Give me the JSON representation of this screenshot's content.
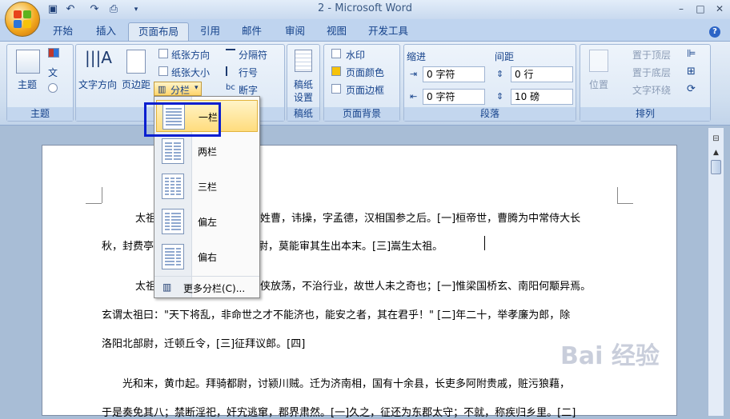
{
  "window": {
    "title": "2 - Microsoft Word"
  },
  "quick_access": [
    "save-icon",
    "undo-icon",
    "redo-icon",
    "print-preview-icon",
    "customize-icon"
  ],
  "window_buttons": {
    "minimize": "–",
    "maximize": "□",
    "close": "✕"
  },
  "tabs": [
    "开始",
    "插入",
    "页面布局",
    "引用",
    "邮件",
    "审阅",
    "视图",
    "开发工具"
  ],
  "active_tab": "页面布局",
  "ribbon": {
    "theme": {
      "label": "主题",
      "button": "主题"
    },
    "page_setup": {
      "text_direction": "文字方向",
      "margins": "页边距",
      "orientation": "纸张方向",
      "size": "纸张大小",
      "columns": "分栏",
      "breaks": "分隔符",
      "line_numbers": "行号",
      "hyphenation": "断字"
    },
    "draft": {
      "label": "稿纸",
      "button1": "稿纸",
      "button2": "设置"
    },
    "page_background": {
      "label": "页面背景",
      "watermark": "水印",
      "page_color": "页面颜色",
      "page_borders": "页面边框"
    },
    "paragraph": {
      "label": "段落",
      "indent": "缩进",
      "spacing": "间距",
      "indent_left": "0 字符",
      "indent_right": "0 字符",
      "spacing_before": "0 行",
      "spacing_after": "10 磅"
    },
    "arrange": {
      "label": "排列",
      "position": "位置",
      "bring_front": "置于顶层",
      "send_back": "置于底层",
      "text_wrap": "文字环绕"
    }
  },
  "columns_menu": {
    "items": [
      "一栏",
      "两栏",
      "三栏",
      "偏左",
      "偏右"
    ],
    "more": "更多分栏(C)..."
  },
  "document": {
    "lines": [
      "太祖武皇帝，沛国谯人也，姓曹，讳操，字孟德，汉相国参之后。[一]桓帝世，曹腾为中常侍大长",
      "秋，封费亭侯。养子嵩嗣，官至太尉，莫能审其生出本末。[三]嵩生太祖。",
      "太祖少机警，有权数，而任侠放荡，不治行业，故世人未之奇也；[一]惟梁国桥玄、南阳何颙异焉。",
      "玄谓太祖曰：\"天下将乱，非命世之才不能济也，能安之者，其在君乎！\"  [二]年二十，举孝廉为郎，除",
      "洛阳北部尉，迁顿丘令，[三]征拜议郎。[四]",
      "光和末，黄巾起。拜骑都尉，讨颍川贼。迁为济南相，国有十余县，长吏多阿附贵戚，赃污狼藉，",
      "于是奏免其八；禁断淫祀，奸宄逃窜，郡界肃然。[一]久之，征还为东郡太守；不就，称疾归乡里。[二]"
    ]
  },
  "watermark": "Bai 经验"
}
